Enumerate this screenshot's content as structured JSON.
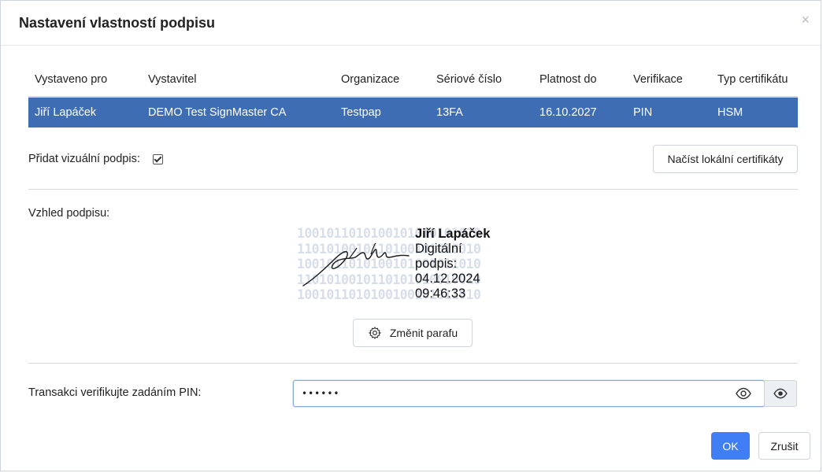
{
  "dialog": {
    "title": "Nastavení vlastností podpisu",
    "close_symbol": "×"
  },
  "table": {
    "headers": [
      "Vystaveno pro",
      "Vystavitel",
      "Organizace",
      "Sériové číslo",
      "Platnost do",
      "Verifikace",
      "Typ certifikátu"
    ],
    "rows": [
      [
        "Jiří Lapáček",
        "DEMO Test SignMaster CA",
        "Testpap",
        "13FA",
        "16.10.2027",
        "PIN",
        "HSM"
      ]
    ]
  },
  "visual_signature": {
    "label": "Přidat vizuální podpis:",
    "checked": true
  },
  "load_button": "Načíst lokální certifikáty",
  "appearance": {
    "label": "Vzhled podpisu:",
    "binary_lines": [
      "1001011010100101010101010",
      "1101010010110100101010010",
      "1001011010100101001011010",
      "1101010010110101010010010",
      "1001011010100100101011010"
    ],
    "signer_name": "Jiří Lapáček",
    "line1": "Digitální",
    "line2": "podpis:",
    "date": "04.12.2024",
    "time": "09:46:33"
  },
  "change_button": "Změnit parafu",
  "pin": {
    "label": "Transakci verifikujte zadáním PIN:",
    "value": "••••••"
  },
  "footer": {
    "ok": "OK",
    "cancel": "Zrušit"
  },
  "colors": {
    "selected_row": "#3f6db4",
    "primary": "#3f7ef5"
  },
  "icons": {
    "close": "close-icon",
    "gear": "gear-icon",
    "eye": "eye-icon"
  }
}
